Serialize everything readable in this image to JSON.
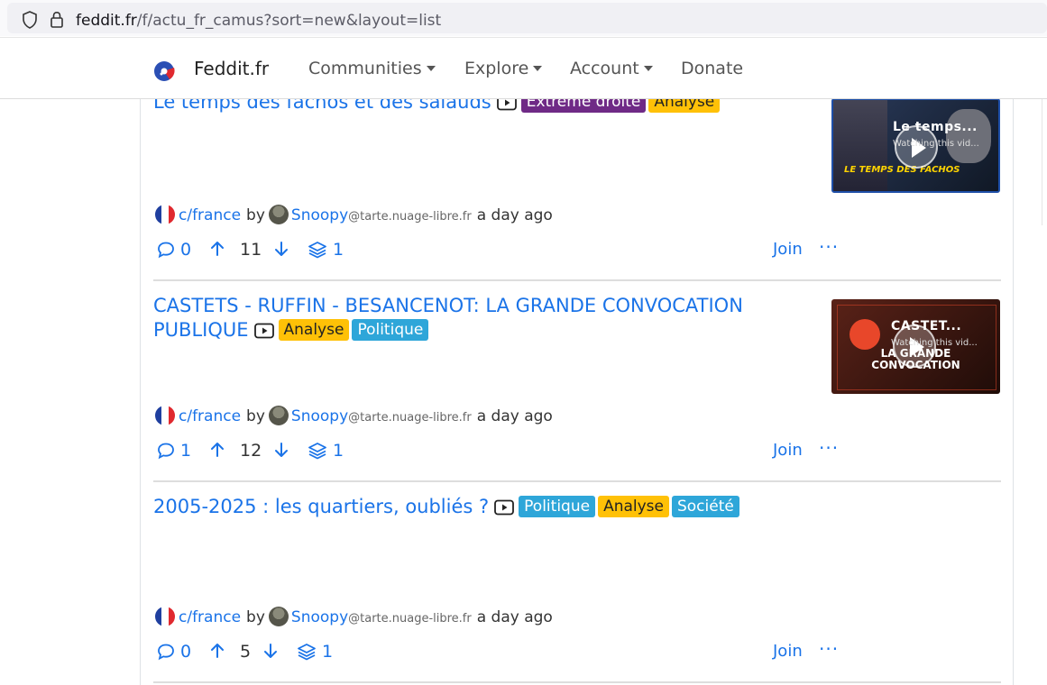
{
  "browser": {
    "url_domain": "feddit.fr",
    "url_path": "/f/actu_fr_camus?sort=new&layout=list"
  },
  "nav": {
    "brand": "Feddit.fr",
    "communities": "Communities",
    "explore": "Explore",
    "account": "Account",
    "donate": "Donate"
  },
  "posts": [
    {
      "title": "Le temps des fachos et des salauds",
      "tags": [
        "Extrême droite",
        "Analyse"
      ],
      "thumbnail": {
        "title": "Le temps...",
        "subtitle": "Watching this vid..."
      },
      "community": "c/france",
      "by": "by",
      "user": "Snoopy",
      "instance": "@tarte.nuage-libre.fr",
      "time": "a day ago",
      "comments": "0",
      "score": "11",
      "crossposts": "1",
      "join": "Join",
      "more": "···"
    },
    {
      "title": "CASTETS - RUFFIN - BESANCENOT: LA GRANDE CONVOCATION PUBLIQUE",
      "tags": [
        "Analyse",
        "Politique"
      ],
      "thumbnail": {
        "title": "CASTET...",
        "subtitle": "Watching this vid..."
      },
      "community": "c/france",
      "by": "by",
      "user": "Snoopy",
      "instance": "@tarte.nuage-libre.fr",
      "time": "a day ago",
      "comments": "1",
      "score": "12",
      "crossposts": "1",
      "join": "Join",
      "more": "···"
    },
    {
      "title": "2005-2025 : les quartiers, oubliés ?",
      "tags": [
        "Politique",
        "Analyse",
        "Société"
      ],
      "community": "c/france",
      "by": "by",
      "user": "Snoopy",
      "instance": "@tarte.nuage-libre.fr",
      "time": "a day ago",
      "comments": "0",
      "score": "5",
      "crossposts": "1",
      "join": "Join",
      "more": "···"
    }
  ],
  "colors": {
    "link": "#1a73e8",
    "tag_purple": "#6f2a86",
    "tag_yellow": "#ffc107",
    "tag_blue": "#2ea6d9"
  }
}
